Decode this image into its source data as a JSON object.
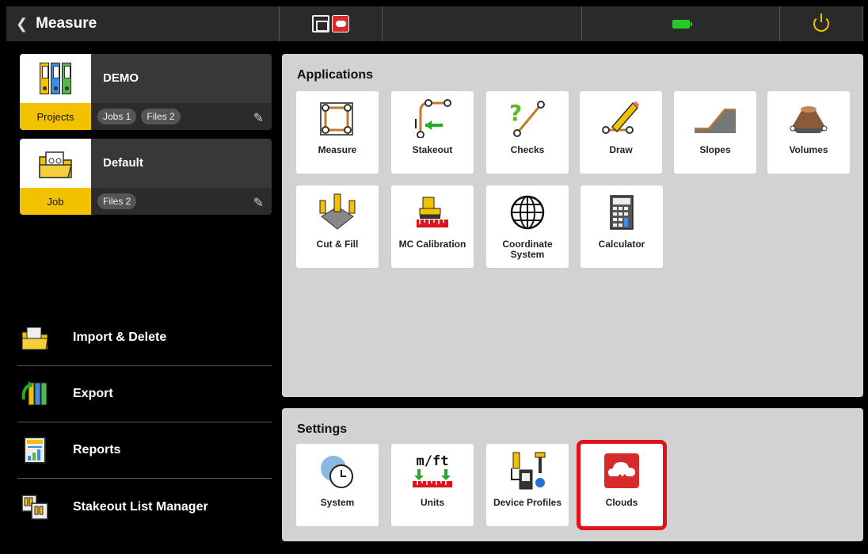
{
  "header": {
    "back_label": "Measure",
    "back_chevron": "❮",
    "icons": [
      "controller-icon",
      "cloud-icon",
      "battery-icon",
      "power-icon"
    ]
  },
  "projects_card": {
    "name": "DEMO",
    "tag": "Projects",
    "jobs": "Jobs 1",
    "files": "Files 2"
  },
  "job_card": {
    "name": "Default",
    "tag": "Job",
    "files": "Files 2"
  },
  "left_menu": [
    {
      "label": "Import & Delete"
    },
    {
      "label": "Export"
    },
    {
      "label": "Reports"
    },
    {
      "label": "Stakeout List Manager"
    }
  ],
  "applications": {
    "title": "Applications",
    "tiles": [
      {
        "label": "Measure"
      },
      {
        "label": "Stakeout"
      },
      {
        "label": "Checks"
      },
      {
        "label": "Draw"
      },
      {
        "label": "Slopes"
      },
      {
        "label": "Volumes"
      },
      {
        "label": "Cut & Fill"
      },
      {
        "label": "MC Calibration"
      },
      {
        "label": "Coordinate System"
      },
      {
        "label": "Calculator"
      }
    ]
  },
  "settings": {
    "title": "Settings",
    "tiles": [
      {
        "label": "System"
      },
      {
        "label": "Units",
        "glyph": "m/ft"
      },
      {
        "label": "Device Profiles"
      },
      {
        "label": "Clouds"
      }
    ]
  },
  "colors": {
    "accent": "#f2c200",
    "selected_outline": "#e0121b",
    "battery": "#29c829",
    "cloud": "#d72b2b"
  }
}
